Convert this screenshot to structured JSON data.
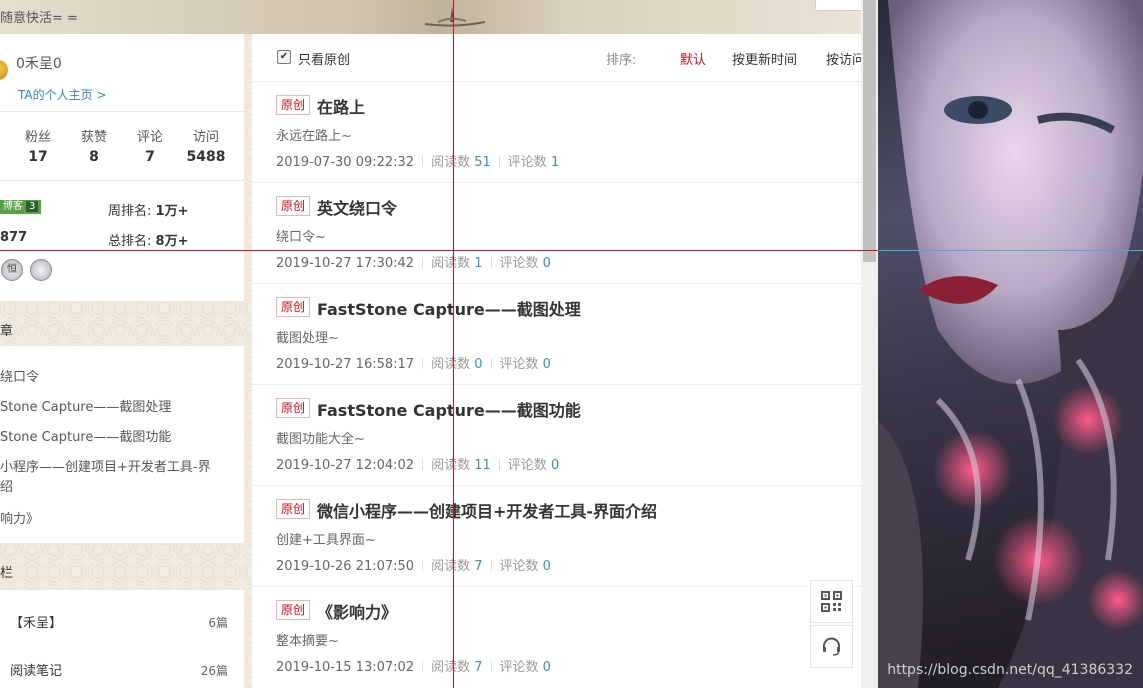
{
  "banner": {
    "slogan": "随意快活= ="
  },
  "profile": {
    "username": "0禾呈0",
    "home_link": "TA的个人主页 >",
    "stats": [
      {
        "label": "粉丝",
        "value": "17"
      },
      {
        "label": "获赞",
        "value": "8"
      },
      {
        "label": "评论",
        "value": "7"
      },
      {
        "label": "访问",
        "value": "5488"
      }
    ],
    "blog_level": {
      "label": "博客",
      "value": "3"
    },
    "points": "877",
    "week_rank": {
      "label": "周排名:",
      "value": "1万+"
    },
    "total_rank": {
      "label": "总排名:",
      "value": "8万+"
    },
    "medal_text": "恒"
  },
  "recent_articles": {
    "heading": "章",
    "items": [
      "绕口令",
      "Stone Capture——截图处理",
      "Stone Capture——截图功能",
      "小程序——创建项目+开发者工具-界",
      "绍",
      "响力》"
    ]
  },
  "columns": {
    "heading": "栏",
    "items": [
      {
        "name": "【禾呈】",
        "count": "6篇"
      },
      {
        "name": "阅读笔记",
        "count": "26篇"
      }
    ]
  },
  "filter": {
    "checkbox_label": "只看原创",
    "sort_label": "排序:",
    "sort_options": [
      "默认",
      "按更新时间",
      "按访问"
    ]
  },
  "articles": [
    {
      "tag": "原创",
      "title": "在路上",
      "desc": "永远在路上~",
      "date": "2019-07-30 09:22:32",
      "read_label": "阅读数",
      "reads": "51",
      "comment_label": "评论数",
      "comments": "1"
    },
    {
      "tag": "原创",
      "title": "英文绕口令",
      "desc": "绕口令~",
      "date": "2019-10-27 17:30:42",
      "read_label": "阅读数",
      "reads": "1",
      "comment_label": "评论数",
      "comments": "0"
    },
    {
      "tag": "原创",
      "title": "FastStone Capture——截图处理",
      "desc": "截图处理~",
      "date": "2019-10-27 16:58:17",
      "read_label": "阅读数",
      "reads": "0",
      "comment_label": "评论数",
      "comments": "0"
    },
    {
      "tag": "原创",
      "title": "FastStone Capture——截图功能",
      "desc": "截图功能大全~",
      "date": "2019-10-27 12:04:02",
      "read_label": "阅读数",
      "reads": "11",
      "comment_label": "评论数",
      "comments": "0"
    },
    {
      "tag": "原创",
      "title": "微信小程序——创建项目+开发者工具-界面介绍",
      "desc": "创建+工具界面~",
      "date": "2019-10-26 21:07:50",
      "read_label": "阅读数",
      "reads": "7",
      "comment_label": "评论数",
      "comments": "0"
    },
    {
      "tag": "原创",
      "title": "《影响力》",
      "desc": "整本摘要~",
      "date": "2019-10-15 13:07:02",
      "read_label": "阅读数",
      "reads": "7",
      "comment_label": "评论数",
      "comments": "0"
    }
  ],
  "tools": {
    "qr_icon": "qr-code-icon",
    "support_icon": "headset-icon"
  },
  "watermark": "https://blog.csdn.net/qq_41386332",
  "colors": {
    "accent_red": "#ca0c16",
    "link_blue": "#3a8ecc",
    "crosshair": "#d0101a"
  }
}
